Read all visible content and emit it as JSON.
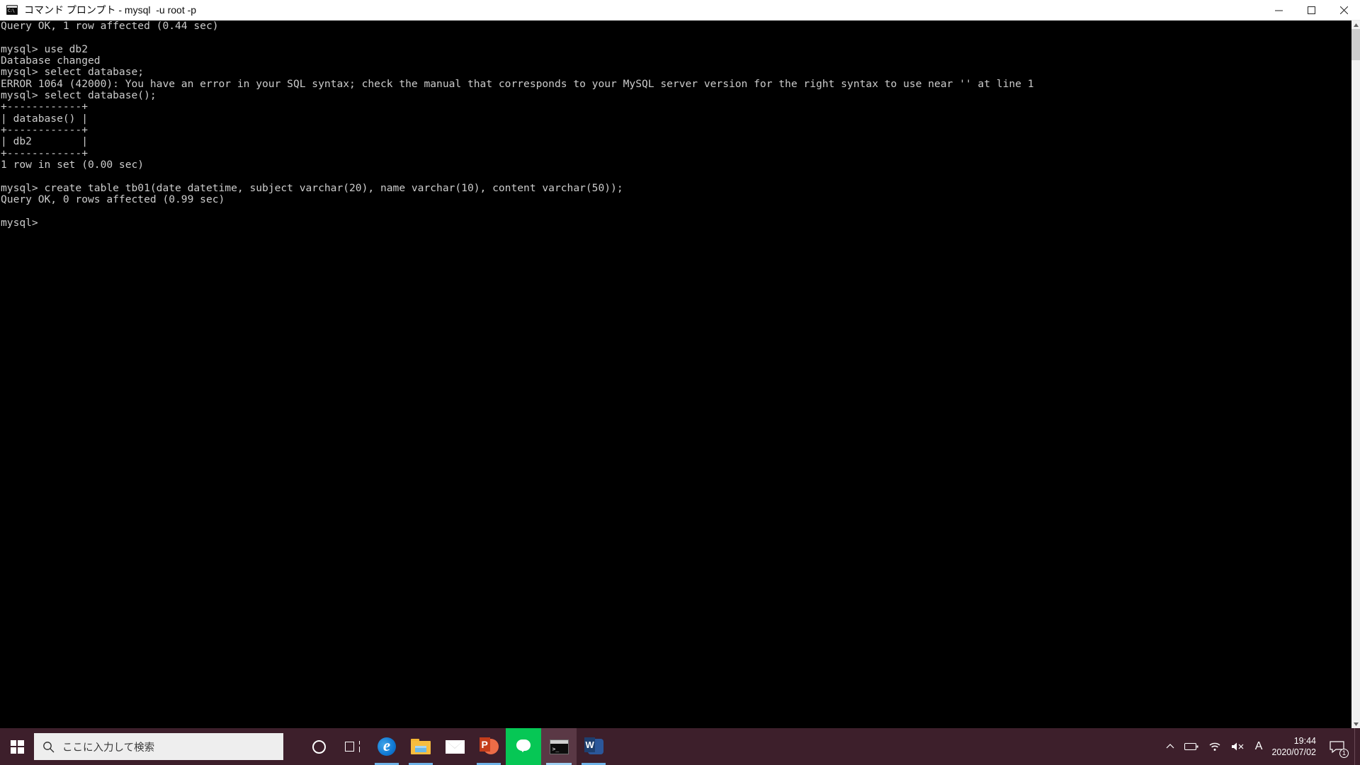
{
  "window": {
    "title": "コマンド プロンプト - mysql  -u root -p",
    "icon": "cmd-icon",
    "controls": {
      "minimize": "minimize-button",
      "maximize": "maximize-button",
      "close": "close-button"
    }
  },
  "console": {
    "lines": [
      "Query OK, 1 row affected (0.44 sec)",
      "",
      "mysql> use db2",
      "Database changed",
      "mysql> select database;",
      "ERROR 1064 (42000): You have an error in your SQL syntax; check the manual that corresponds to your MySQL server version for the right syntax to use near '' at line 1",
      "mysql> select database();",
      "+------------+",
      "| database() |",
      "+------------+",
      "| db2        |",
      "+------------+",
      "1 row in set (0.00 sec)",
      "",
      "mysql> create table tb01(date datetime, subject varchar(20), name varchar(10), content varchar(50));",
      "Query OK, 0 rows affected (0.99 sec)",
      "",
      "mysql>"
    ],
    "background": "#000000",
    "foreground": "#cccccc"
  },
  "scrollbar": {
    "up_arrow": "scroll-up-arrow",
    "down_arrow": "scroll-down-arrow"
  },
  "taskbar": {
    "background": "#3d1f2b",
    "start": "windows-logo",
    "search": {
      "placeholder": "ここに入力して検索",
      "icon": "search-icon"
    },
    "apps": [
      {
        "name": "cortana",
        "label": "Cortana",
        "active": false
      },
      {
        "name": "task-view",
        "label": "タスク ビュー",
        "active": false
      },
      {
        "name": "microsoft-edge",
        "label": "Microsoft Edge",
        "active": true
      },
      {
        "name": "file-explorer",
        "label": "エクスプローラー",
        "active": true
      },
      {
        "name": "mail",
        "label": "メール",
        "active": false
      },
      {
        "name": "powerpoint",
        "label": "PowerPoint",
        "active": true
      },
      {
        "name": "line",
        "label": "LINE",
        "active": true
      },
      {
        "name": "command-prompt",
        "label": "コマンド プロンプト",
        "active": true
      },
      {
        "name": "word",
        "label": "Word",
        "active": true
      }
    ],
    "tray": {
      "chevron": "show-hidden-icons",
      "battery": "battery-icon",
      "network": "wifi-icon",
      "volume": "volume-muted-icon",
      "ime": "A",
      "time": "19:44",
      "date": "2020/07/02",
      "notifications": "notification-icon",
      "notification_count": "1"
    }
  }
}
